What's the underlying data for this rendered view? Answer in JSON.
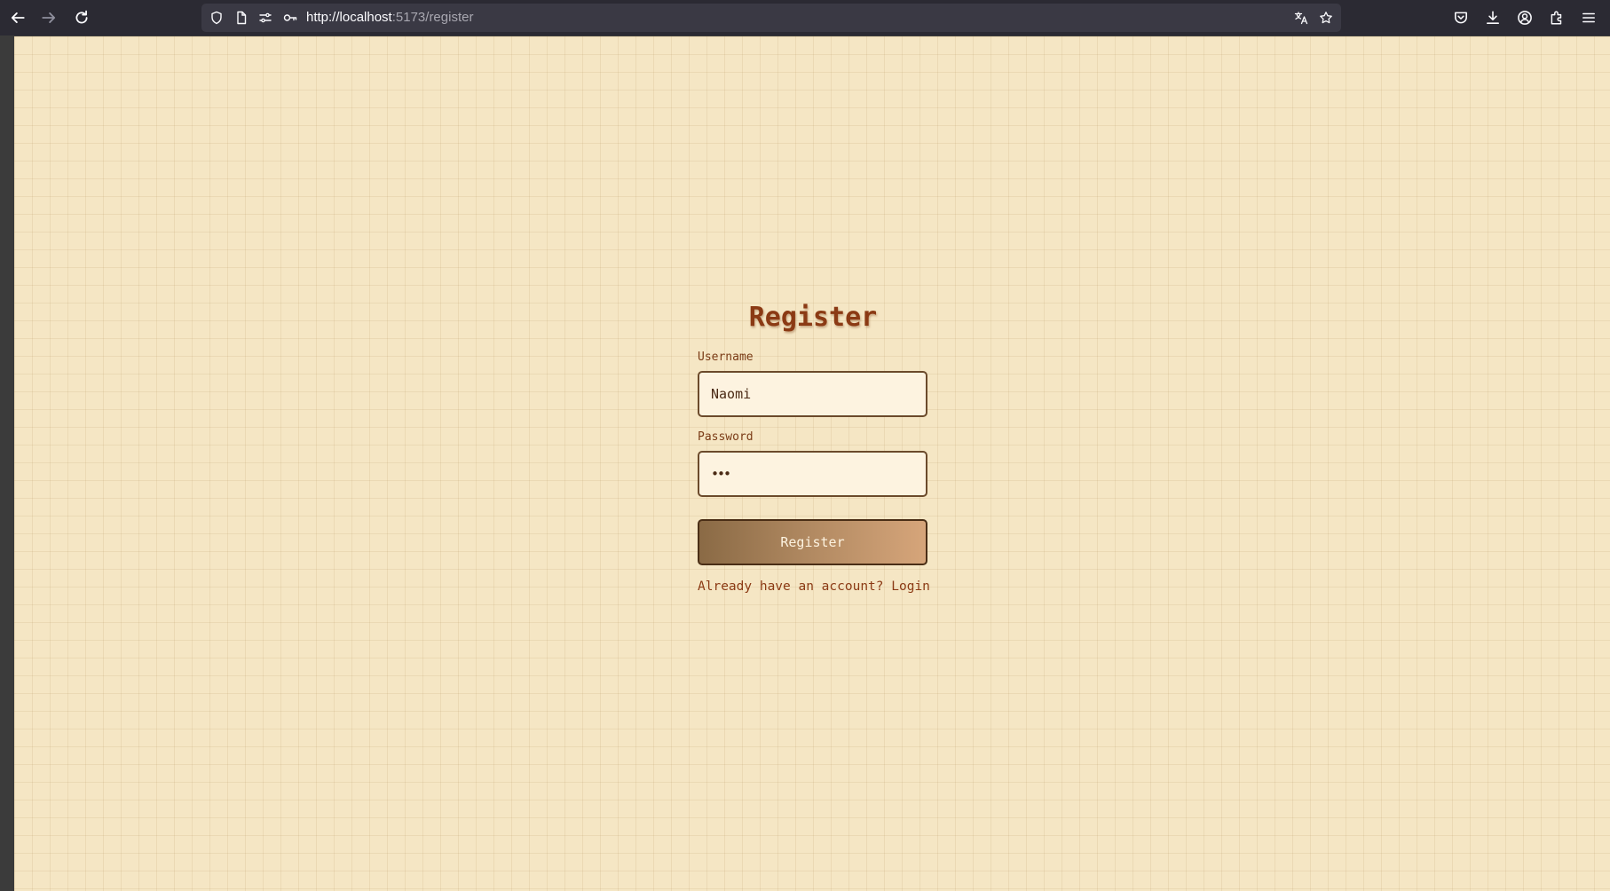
{
  "browser": {
    "url_host": "http://localhost",
    "url_rest": ":5173/register",
    "icons": {
      "back": "arrow-left-icon",
      "forward": "arrow-right-icon",
      "reload": "reload-icon",
      "shield": "shield-icon",
      "page": "page-icon",
      "permissions": "permissions-icon",
      "key": "key-icon",
      "translate": "translate-icon",
      "bookmark": "star-icon",
      "pocket": "pocket-icon",
      "downloads": "download-icon",
      "account": "account-icon",
      "extensions": "puzzle-icon",
      "menu": "hamburger-menu-icon"
    }
  },
  "page": {
    "title": "Register",
    "username": {
      "label": "Username",
      "value": "Naomi"
    },
    "password": {
      "label": "Password",
      "value": "•••"
    },
    "submit_label": "Register",
    "switch_prompt": "Already have an account?",
    "switch_link": "Login"
  },
  "colors": {
    "background": "#f5e6c4",
    "accent": "#8b3a14",
    "input_bg": "#fdf3e0",
    "button_gradient_start": "#8a6a45",
    "button_gradient_end": "#d6a57a"
  }
}
